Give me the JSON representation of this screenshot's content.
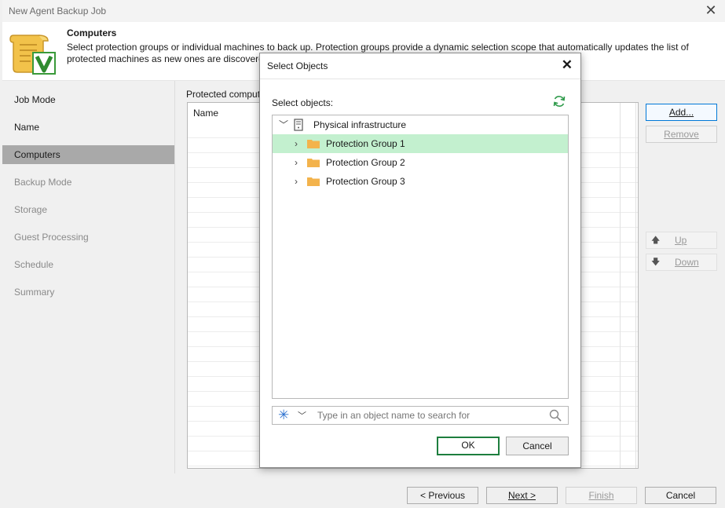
{
  "window": {
    "title": "New Agent Backup Job",
    "close_glyph": "✕"
  },
  "header": {
    "title": "Computers",
    "description": "Select protection groups or individual machines to back up. Protection groups provide a dynamic selection scope that automatically updates the list of\nprotected machines as new ones are discovered.",
    "logo_icon": "veeam-scroll-logo-icon"
  },
  "sidebar": {
    "items": [
      {
        "label": "Job Mode",
        "state": "normal"
      },
      {
        "label": "Name",
        "state": "normal"
      },
      {
        "label": "Computers",
        "state": "active"
      },
      {
        "label": "Backup Mode",
        "state": "dim"
      },
      {
        "label": "Storage",
        "state": "dim"
      },
      {
        "label": "Guest Processing",
        "state": "dim"
      },
      {
        "label": "Schedule",
        "state": "dim"
      },
      {
        "label": "Summary",
        "state": "dim"
      }
    ]
  },
  "main": {
    "protected_label": "Protected computers:",
    "column_name": "Name",
    "buttons": {
      "add": "Add...",
      "remove": "Remove",
      "up": "Up",
      "down": "Down"
    }
  },
  "footer": {
    "previous": "< Previous",
    "next": "Next >",
    "finish": "Finish",
    "cancel": "Cancel"
  },
  "dialog": {
    "title": "Select Objects",
    "close_glyph": "✕",
    "select_label": "Select objects:",
    "tree": {
      "root": {
        "label": "Physical infrastructure",
        "expanded": true,
        "icon": "server-icon"
      },
      "children": [
        {
          "label": "Protection Group 1",
          "selected": true,
          "icon": "folder-icon"
        },
        {
          "label": "Protection Group 2",
          "selected": false,
          "icon": "folder-icon"
        },
        {
          "label": "Protection Group 3",
          "selected": false,
          "icon": "folder-icon"
        }
      ]
    },
    "search": {
      "placeholder": "Type in an object name to search for",
      "value": ""
    },
    "ok": "OK",
    "cancel": "Cancel"
  },
  "colors": {
    "selection": "#c3f0cf",
    "active_nav": "#a9a9a9",
    "ok_border": "#1e7e3e",
    "accent_blue": "#0078d7",
    "folder": "#f3b34c"
  }
}
